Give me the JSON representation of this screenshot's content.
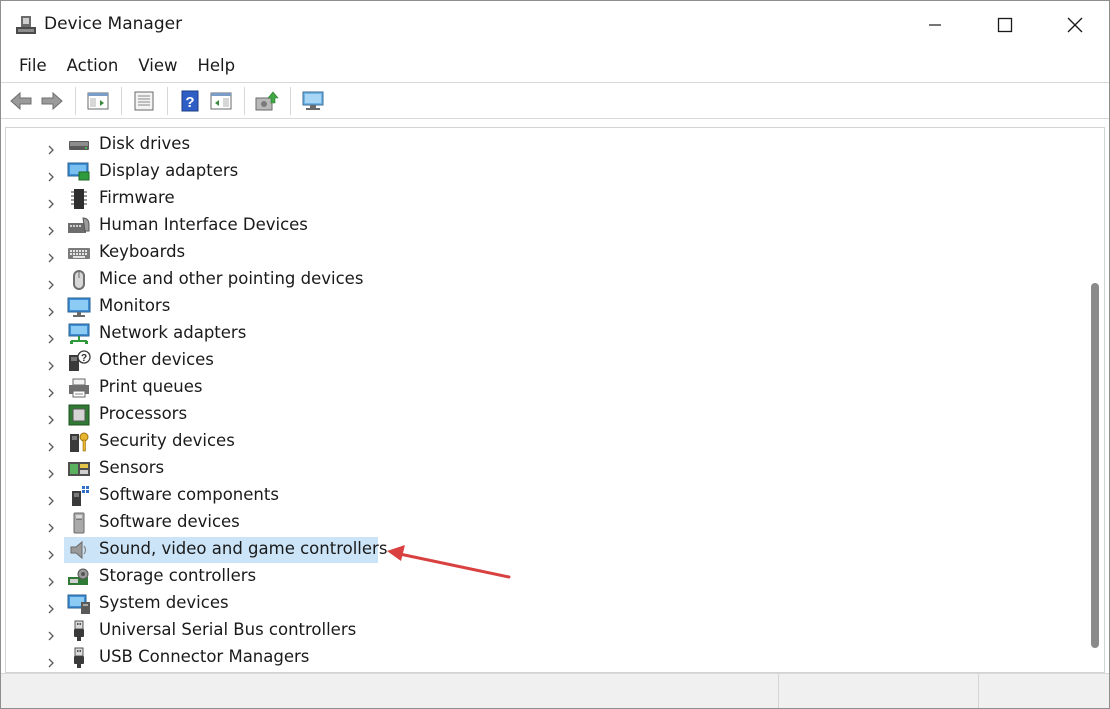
{
  "window": {
    "title": "Device Manager"
  },
  "menu": [
    "File",
    "Action",
    "View",
    "Help"
  ],
  "toolbar": {
    "buttons": [
      "back-icon",
      "forward-icon",
      "show-hide-console-tree-icon",
      "properties-icon",
      "help-icon",
      "action-pane-icon",
      "update-driver-icon",
      "scan-hardware-icon"
    ]
  },
  "tree": {
    "items": [
      {
        "label": "Disk drives",
        "icon": "disk-drive-icon"
      },
      {
        "label": "Display adapters",
        "icon": "display-adapter-icon"
      },
      {
        "label": "Firmware",
        "icon": "firmware-icon"
      },
      {
        "label": "Human Interface Devices",
        "icon": "hid-icon"
      },
      {
        "label": "Keyboards",
        "icon": "keyboard-icon"
      },
      {
        "label": "Mice and other pointing devices",
        "icon": "mouse-icon"
      },
      {
        "label": "Monitors",
        "icon": "monitor-icon"
      },
      {
        "label": "Network adapters",
        "icon": "network-adapter-icon"
      },
      {
        "label": "Other devices",
        "icon": "other-devices-icon"
      },
      {
        "label": "Print queues",
        "icon": "printer-icon"
      },
      {
        "label": "Processors",
        "icon": "processor-icon"
      },
      {
        "label": "Security devices",
        "icon": "security-device-icon"
      },
      {
        "label": "Sensors",
        "icon": "sensor-icon"
      },
      {
        "label": "Software components",
        "icon": "software-component-icon"
      },
      {
        "label": "Software devices",
        "icon": "software-device-icon"
      },
      {
        "label": "Sound, video and game controllers",
        "icon": "speaker-icon",
        "selected": true
      },
      {
        "label": "Storage controllers",
        "icon": "storage-controller-icon"
      },
      {
        "label": "System devices",
        "icon": "system-device-icon"
      },
      {
        "label": "Universal Serial Bus controllers",
        "icon": "usb-icon"
      },
      {
        "label": "USB Connector Managers",
        "icon": "usb-connector-icon"
      }
    ]
  },
  "colors": {
    "selection": "#cce4f7",
    "annotation_arrow": "#d94040"
  }
}
